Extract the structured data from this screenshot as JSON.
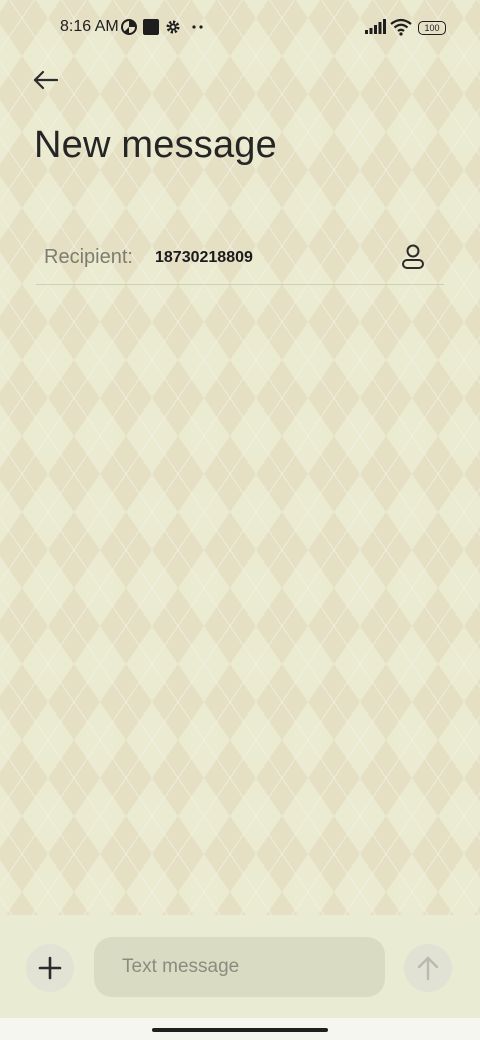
{
  "status_bar": {
    "time": "8:16 AM",
    "battery": "100",
    "icons": [
      "data-saver-icon",
      "square-notification-icon",
      "settings-gear-icon",
      "more-dots-icon",
      "signal-icon",
      "wifi-icon",
      "battery-icon"
    ]
  },
  "header": {
    "back_icon": "arrow-left-icon",
    "title": "New message"
  },
  "recipient": {
    "label": "Recipient:",
    "value": "18730218809",
    "contact_icon": "person-icon"
  },
  "composer": {
    "add_icon": "plus-icon",
    "placeholder": "Text message",
    "send_icon": "arrow-up-icon"
  },
  "colors": {
    "background": "#ebebd2",
    "pattern_diamond": "#e4ddc0",
    "input_bg": "#d9dcc3"
  }
}
